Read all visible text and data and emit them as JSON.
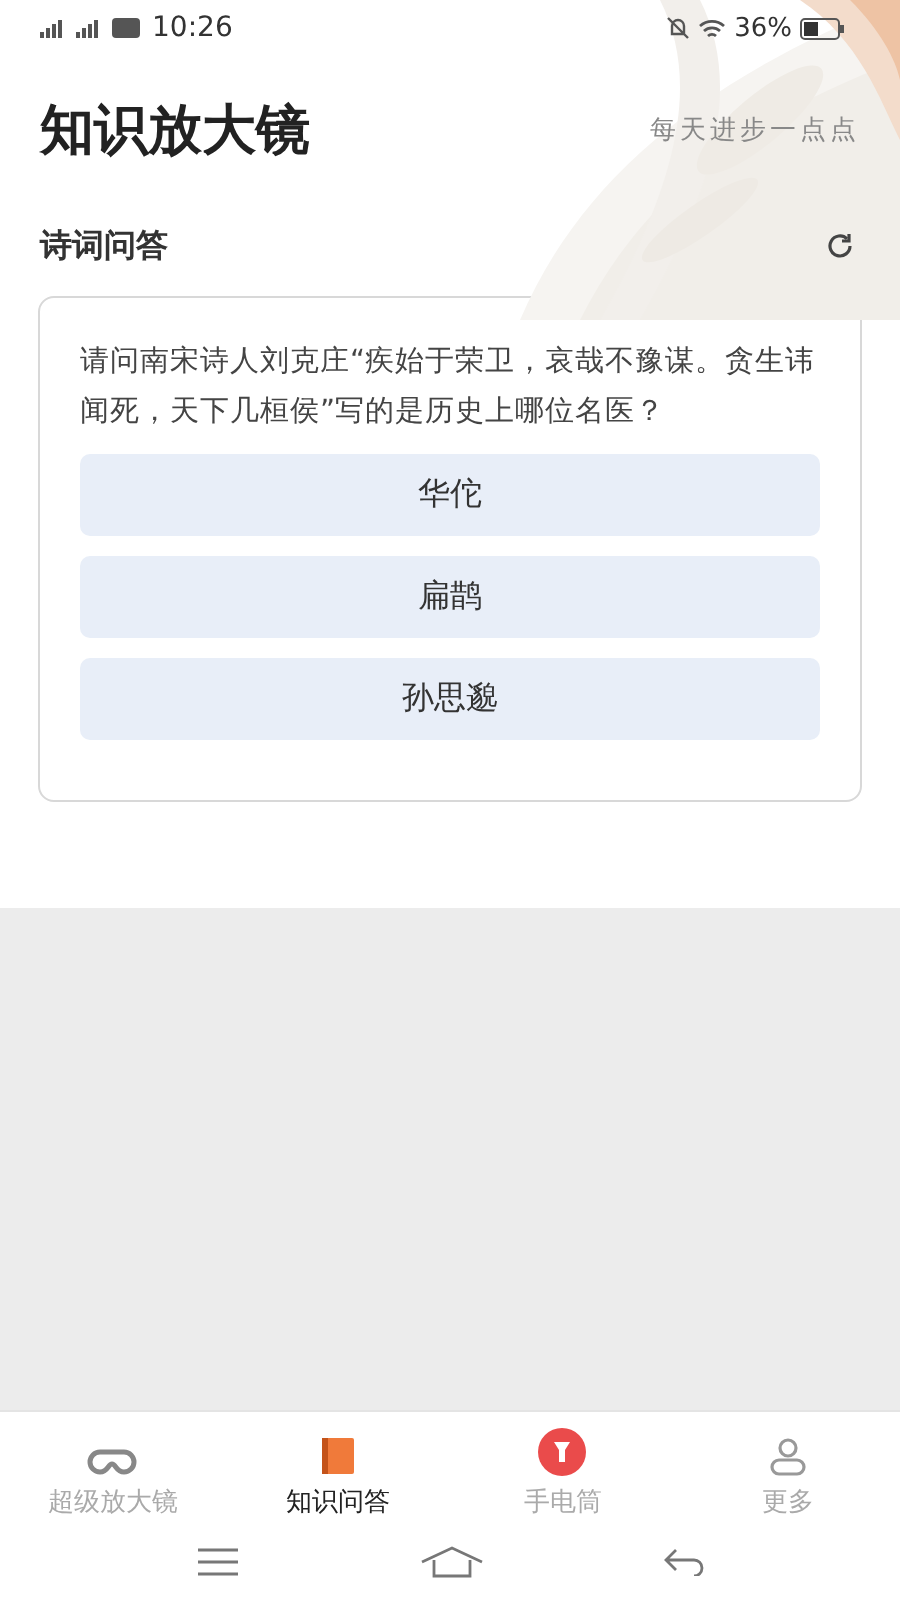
{
  "status_bar": {
    "time": "10:26",
    "battery": "36%"
  },
  "header": {
    "title": "知识放大镜",
    "slogan": "每天进步一点点"
  },
  "section": {
    "title": "诗词问答"
  },
  "question": {
    "text": "请问南宋诗人刘克庄“疾始于荣卫，哀哉不豫谋。贪生讳闻死，天下几桓侯”写的是历史上哪位名医？",
    "options": [
      "华佗",
      "扁鹊",
      "孙思邈"
    ]
  },
  "tabs": [
    {
      "label": "超级放大镜",
      "kind": "glasses",
      "selected": false
    },
    {
      "label": "知识问答",
      "kind": "book",
      "selected": true
    },
    {
      "label": "手电筒",
      "kind": "torch",
      "selected": false
    },
    {
      "label": "更多",
      "kind": "person",
      "selected": false
    }
  ]
}
